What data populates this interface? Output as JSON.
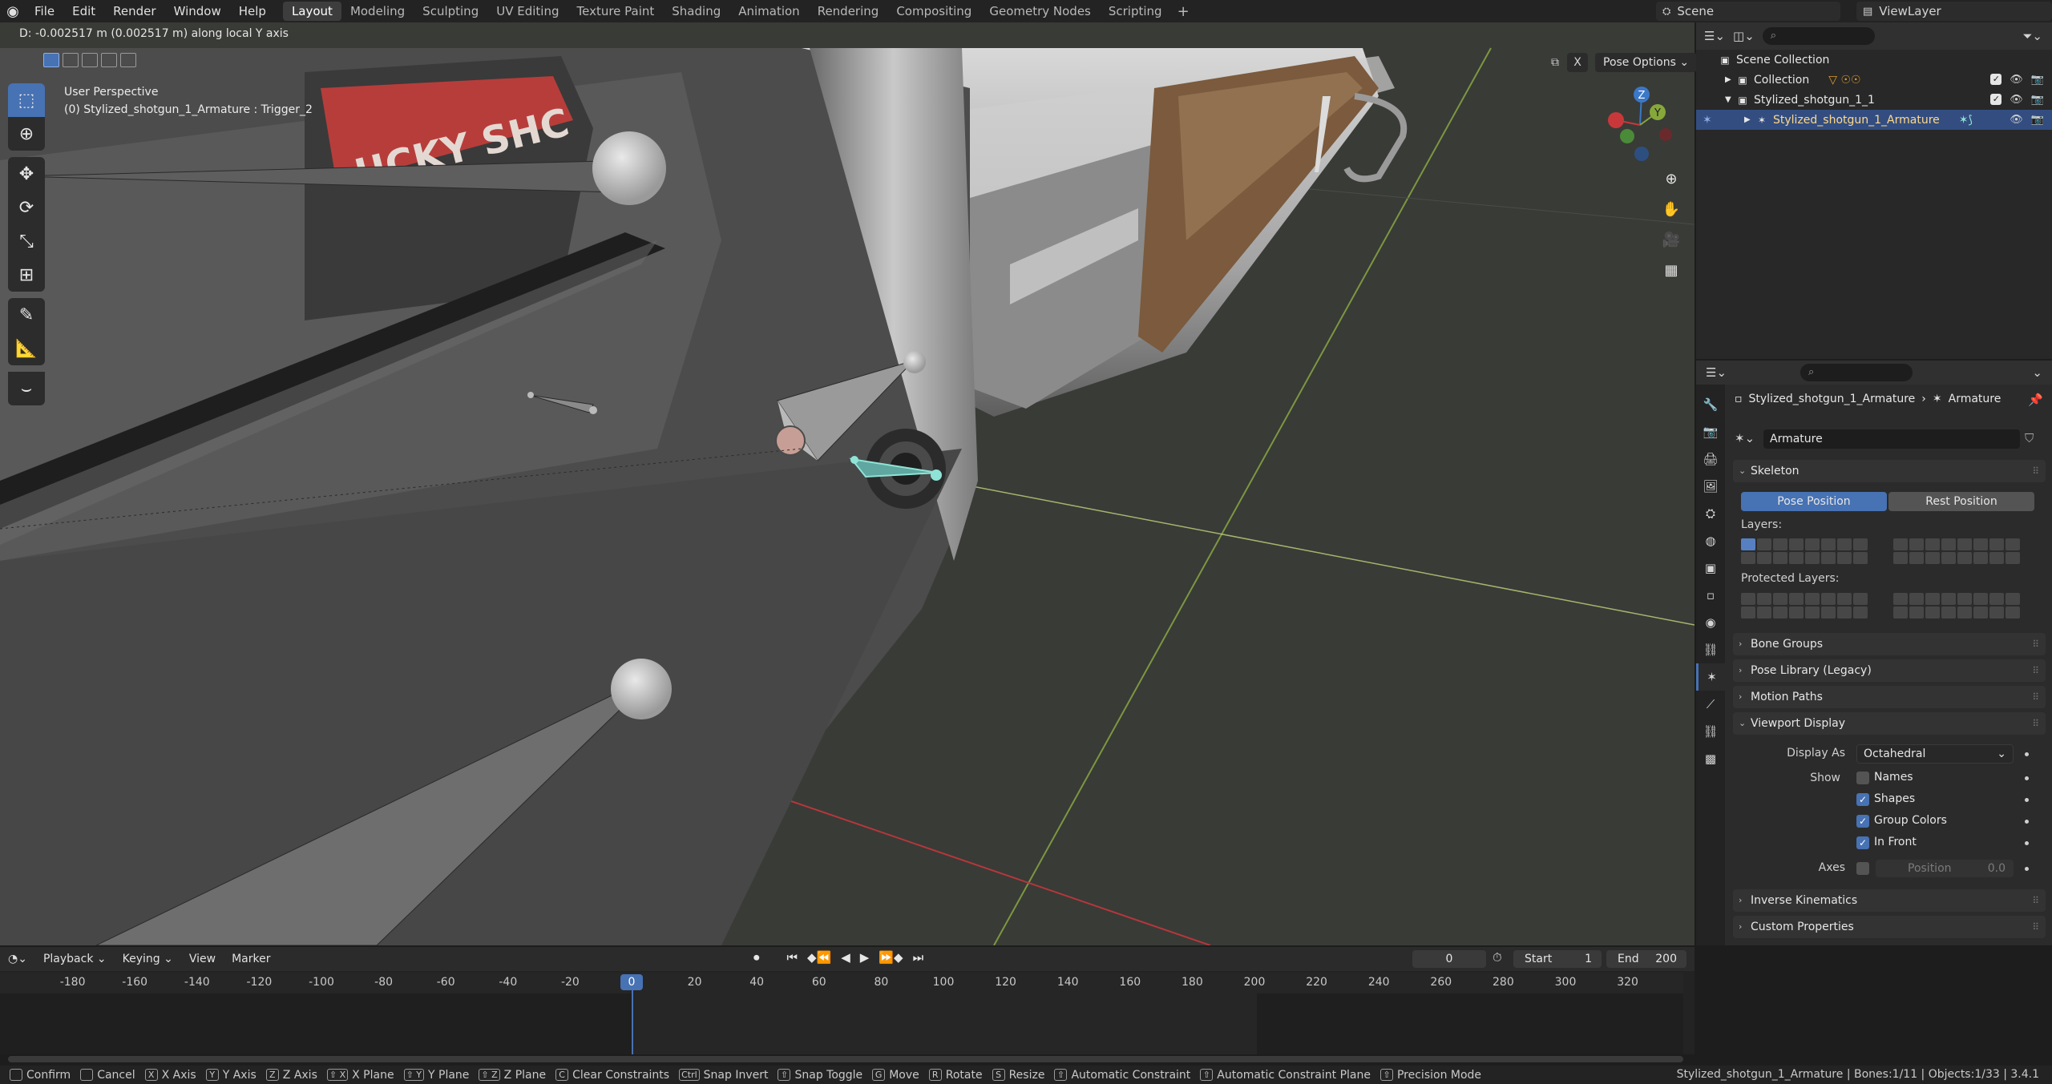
{
  "topbar": {
    "menus": [
      "File",
      "Edit",
      "Render",
      "Window",
      "Help"
    ],
    "workspaces": [
      "Layout",
      "Modeling",
      "Sculpting",
      "UV Editing",
      "Texture Paint",
      "Shading",
      "Animation",
      "Rendering",
      "Compositing",
      "Geometry Nodes",
      "Scripting"
    ],
    "active_workspace": "Layout",
    "add_workspace": "+",
    "scene": "Scene",
    "view_layer": "ViewLayer"
  },
  "viewport": {
    "operator_status": "D: -0.002517 m (0.002517 m) along local Y axis",
    "view_name": "User Perspective",
    "object_info": "(0) Stylized_shotgun_1_Armature : Trigger_2",
    "pose_options": "Pose Options",
    "x_toggle": "X",
    "decal_text": "UCKY SHC",
    "gizmo": {
      "x": "X",
      "y": "Y",
      "z": "Z"
    }
  },
  "outliner": {
    "search_placeholder": "",
    "rows": [
      {
        "label": "Scene Collection",
        "icon": "scene-collection-icon"
      },
      {
        "label": "Collection",
        "icon": "collection-icon"
      },
      {
        "label": "Stylized_shotgun_1_1",
        "icon": "collection-icon"
      },
      {
        "label": "Stylized_shotgun_1_Armature",
        "icon": "armature-icon"
      }
    ]
  },
  "properties": {
    "breadcrumb_object": "Stylized_shotgun_1_Armature",
    "breadcrumb_data": "Armature",
    "data_name": "Armature",
    "skeleton": {
      "title": "Skeleton",
      "pose_position": "Pose Position",
      "rest_position": "Rest Position",
      "layers_label": "Layers:",
      "protected_label": "Protected Layers:"
    },
    "collapsed_panels": [
      "Bone Groups",
      "Pose Library (Legacy)",
      "Motion Paths"
    ],
    "viewport_display": {
      "title": "Viewport Display",
      "display_as_label": "Display As",
      "display_as_value": "Octahedral",
      "show_label": "Show",
      "names": "Names",
      "shapes": "Shapes",
      "group_colors": "Group Colors",
      "in_front": "In Front",
      "axes_label": "Axes",
      "position_label": "Position",
      "position_value": "0.0"
    },
    "bottom_panels": [
      "Inverse Kinematics",
      "Custom Properties"
    ]
  },
  "timeline": {
    "menus": [
      "Playback",
      "Keying",
      "View",
      "Marker"
    ],
    "current_frame": "0",
    "start_label": "Start",
    "start_value": "1",
    "end_label": "End",
    "end_value": "200",
    "ticks": [
      "-180",
      "-160",
      "-140",
      "-120",
      "-100",
      "-80",
      "-60",
      "-40",
      "-20",
      "0",
      "20",
      "40",
      "60",
      "80",
      "100",
      "120",
      "140",
      "160",
      "180",
      "200",
      "220",
      "240",
      "260",
      "280",
      "300",
      "320"
    ]
  },
  "statusbar": {
    "items": [
      {
        "key": "",
        "label": "Confirm"
      },
      {
        "key": "",
        "label": "Cancel"
      },
      {
        "key": "X",
        "label": "X Axis"
      },
      {
        "key": "Y",
        "label": "Y Axis"
      },
      {
        "key": "Z",
        "label": "Z Axis"
      },
      {
        "key": "⇧ X",
        "label": "X Plane"
      },
      {
        "key": "⇧ Y",
        "label": "Y Plane"
      },
      {
        "key": "⇧ Z",
        "label": "Z Plane"
      },
      {
        "key": "C",
        "label": "Clear Constraints"
      },
      {
        "key": "Ctrl",
        "label": "Snap Invert"
      },
      {
        "key": "⇧",
        "label": "Snap Toggle"
      },
      {
        "key": "G",
        "label": "Move"
      },
      {
        "key": "R",
        "label": "Rotate"
      },
      {
        "key": "S",
        "label": "Resize"
      },
      {
        "key": "⇧",
        "label": "Automatic Constraint"
      },
      {
        "key": "⇧",
        "label": "Automatic Constraint Plane"
      },
      {
        "key": "⇧",
        "label": "Precision Mode"
      }
    ],
    "right": "Stylized_shotgun_1_Armature | Bones:1/11 | Objects:1/33 | 3.4.1"
  },
  "colors": {
    "accent": "#4772b3",
    "selected_row": "#334d80",
    "axis_x": "#c8383a",
    "axis_y": "#86a83a",
    "axis_z": "#3a78c8",
    "active_bone": "#8fe3d6"
  }
}
